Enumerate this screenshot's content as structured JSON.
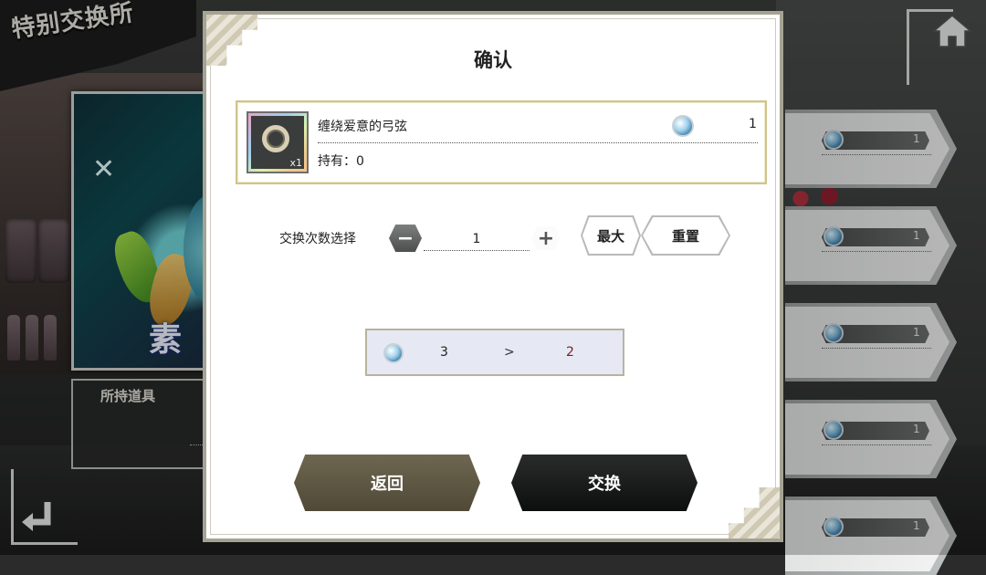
{
  "screen_title": "特别交换所",
  "banner_label": "素材",
  "held_items_label": "所持道具",
  "side_list": [
    {
      "count": "1"
    },
    {
      "count": "1"
    },
    {
      "count": "1"
    },
    {
      "count": "1"
    },
    {
      "count": "1"
    }
  ],
  "dialog": {
    "title": "确认",
    "item": {
      "name": "缠绕爱意的弓弦",
      "icon_qty": "x1",
      "cost": "1",
      "held": "持有：0"
    },
    "quantity": {
      "label": "交换次数选择",
      "value": "1",
      "max_label": "最大",
      "reset_label": "重置"
    },
    "summary": {
      "before": "3",
      "arrow": ">",
      "after": "2"
    },
    "back_label": "返回",
    "exchange_label": "交换"
  },
  "colors": {
    "dialog_border": "#a5a393",
    "item_box_border": "#cfc48c",
    "summary_bg": "#e6e8f3",
    "after_value": "#7a1f1f",
    "back_button": "#5f5842",
    "exchange_button": "#1a1b1b"
  },
  "icons": {
    "home": "home-icon",
    "back": "return-arrow-icon",
    "currency": "blue-gem-icon",
    "item": "bowstring-coil-icon"
  }
}
